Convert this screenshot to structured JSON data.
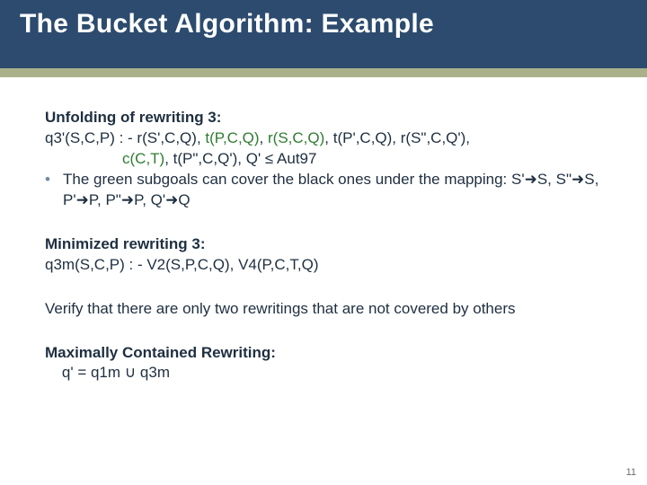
{
  "title": "The Bucket Algorithm: Example",
  "block1": {
    "heading": "Unfolding of rewriting 3:",
    "line1_lead": "q3'(S,C,P) : - r(S',C,Q), ",
    "line1_g1": "t(P,C,Q)",
    "line1_mid1": ", ",
    "line1_g2": "r(S,C,Q)",
    "line1_mid2": ", t(P',C,Q), r(S\",C,Q'),",
    "line2_g3": "c(C,T)",
    "line2_tail": ", t(P\",C,Q'), Q' ≤ Aut97",
    "bullet_a": "The green subgoals can cover the black ones under the mapping: S'",
    "bullet_b": "S, S\"",
    "bullet_c": "S, P'",
    "bullet_d": "P, P\"",
    "bullet_e": "P, Q'",
    "bullet_f": "Q"
  },
  "block2": {
    "heading": "Minimized rewriting 3:",
    "line": "q3m(S,C,P) : - V2(S,P,C,Q), V4(P,C,T,Q)"
  },
  "block3": {
    "line": "Verify that there are only two rewritings that are not covered by others"
  },
  "block4": {
    "heading": "Maximally Contained Rewriting:",
    "line": "    q' = q1m ∪ q3m"
  },
  "glyphs": {
    "bullet": "•",
    "arrow": "➜"
  },
  "page": "11"
}
